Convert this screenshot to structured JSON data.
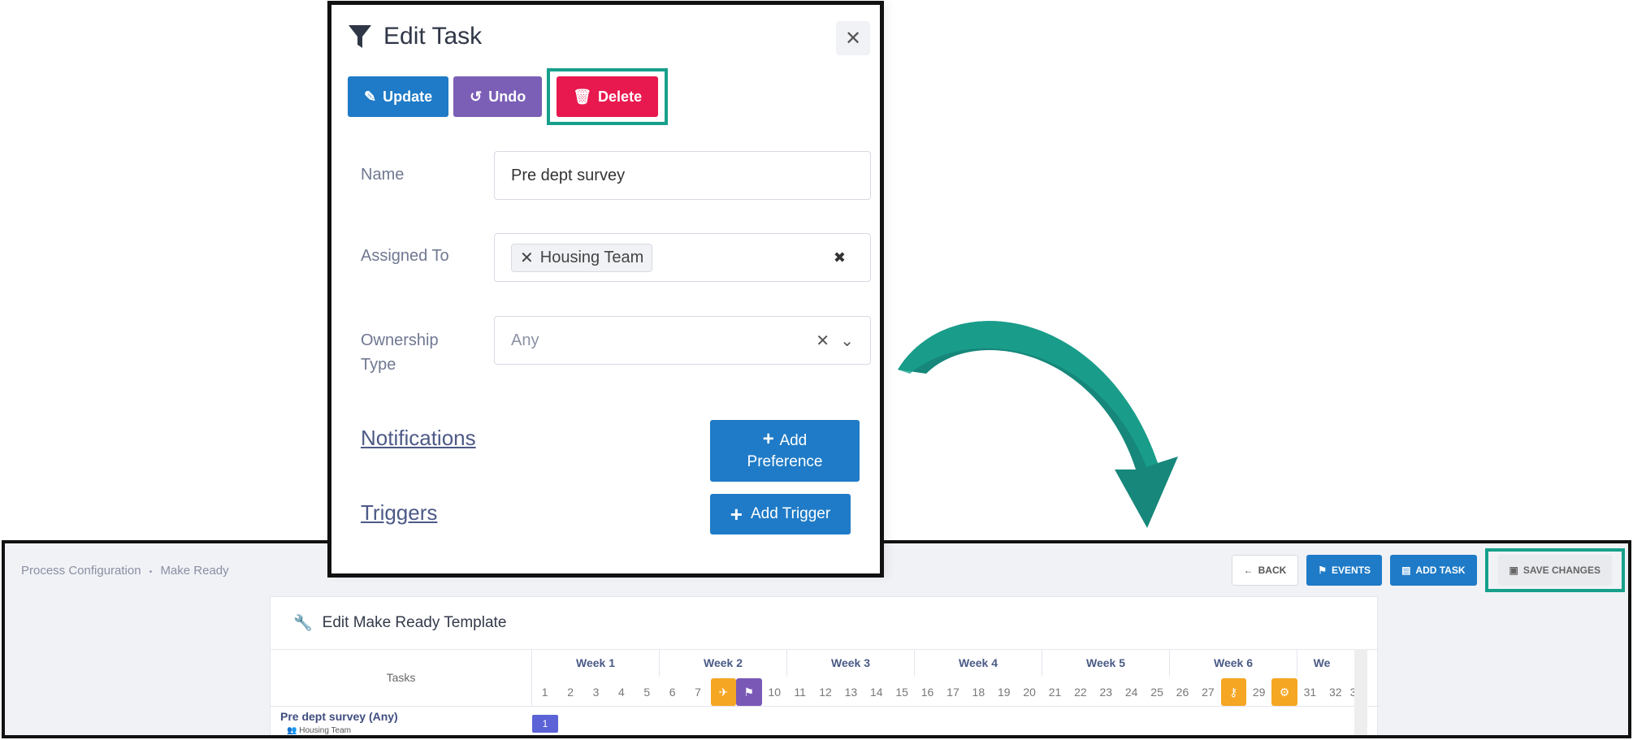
{
  "modal": {
    "title": "Edit Task",
    "buttons": {
      "update": "Update",
      "undo": "Undo",
      "delete": "Delete"
    },
    "fields": {
      "name_label": "Name",
      "name_value": "Pre dept survey",
      "assigned_label": "Assigned To",
      "assigned_chip": "Housing Team",
      "ownership_label_1": "Ownership",
      "ownership_label_2": "Type",
      "ownership_placeholder": "Any"
    },
    "notifications_label": "Notifications",
    "add_preference_line1": "Add",
    "add_preference_line2": "Preference",
    "triggers_label": "Triggers",
    "add_trigger": "Add Trigger"
  },
  "app": {
    "breadcrumb": [
      "Process Configuration",
      "Make Ready"
    ],
    "toolbar": {
      "back": "BACK",
      "events": "EVENTS",
      "add_task": "ADD TASK",
      "save": "SAVE CHANGES"
    },
    "card_title": "Edit Make Ready Template",
    "tasks_header": "Tasks",
    "weeks": [
      "Week 1",
      "Week 2",
      "Week 3",
      "Week 4",
      "Week 5",
      "Week 6",
      "We"
    ],
    "days": [
      "1",
      "2",
      "3",
      "4",
      "5",
      "6",
      "7",
      "",
      "",
      "10",
      "11",
      "12",
      "13",
      "14",
      "15",
      "16",
      "17",
      "18",
      "19",
      "20",
      "21",
      "22",
      "23",
      "24",
      "25",
      "26",
      "27",
      "",
      "29",
      "",
      "31",
      "32",
      "3"
    ],
    "task": {
      "name": "Pre dept survey (Any)",
      "team": "Housing Team",
      "marker": "1"
    }
  },
  "colors": {
    "accent_teal": "#16a08b",
    "primary_blue": "#1f7bc7",
    "delete_red": "#e8194f",
    "undo_purple": "#7b5fb6"
  }
}
